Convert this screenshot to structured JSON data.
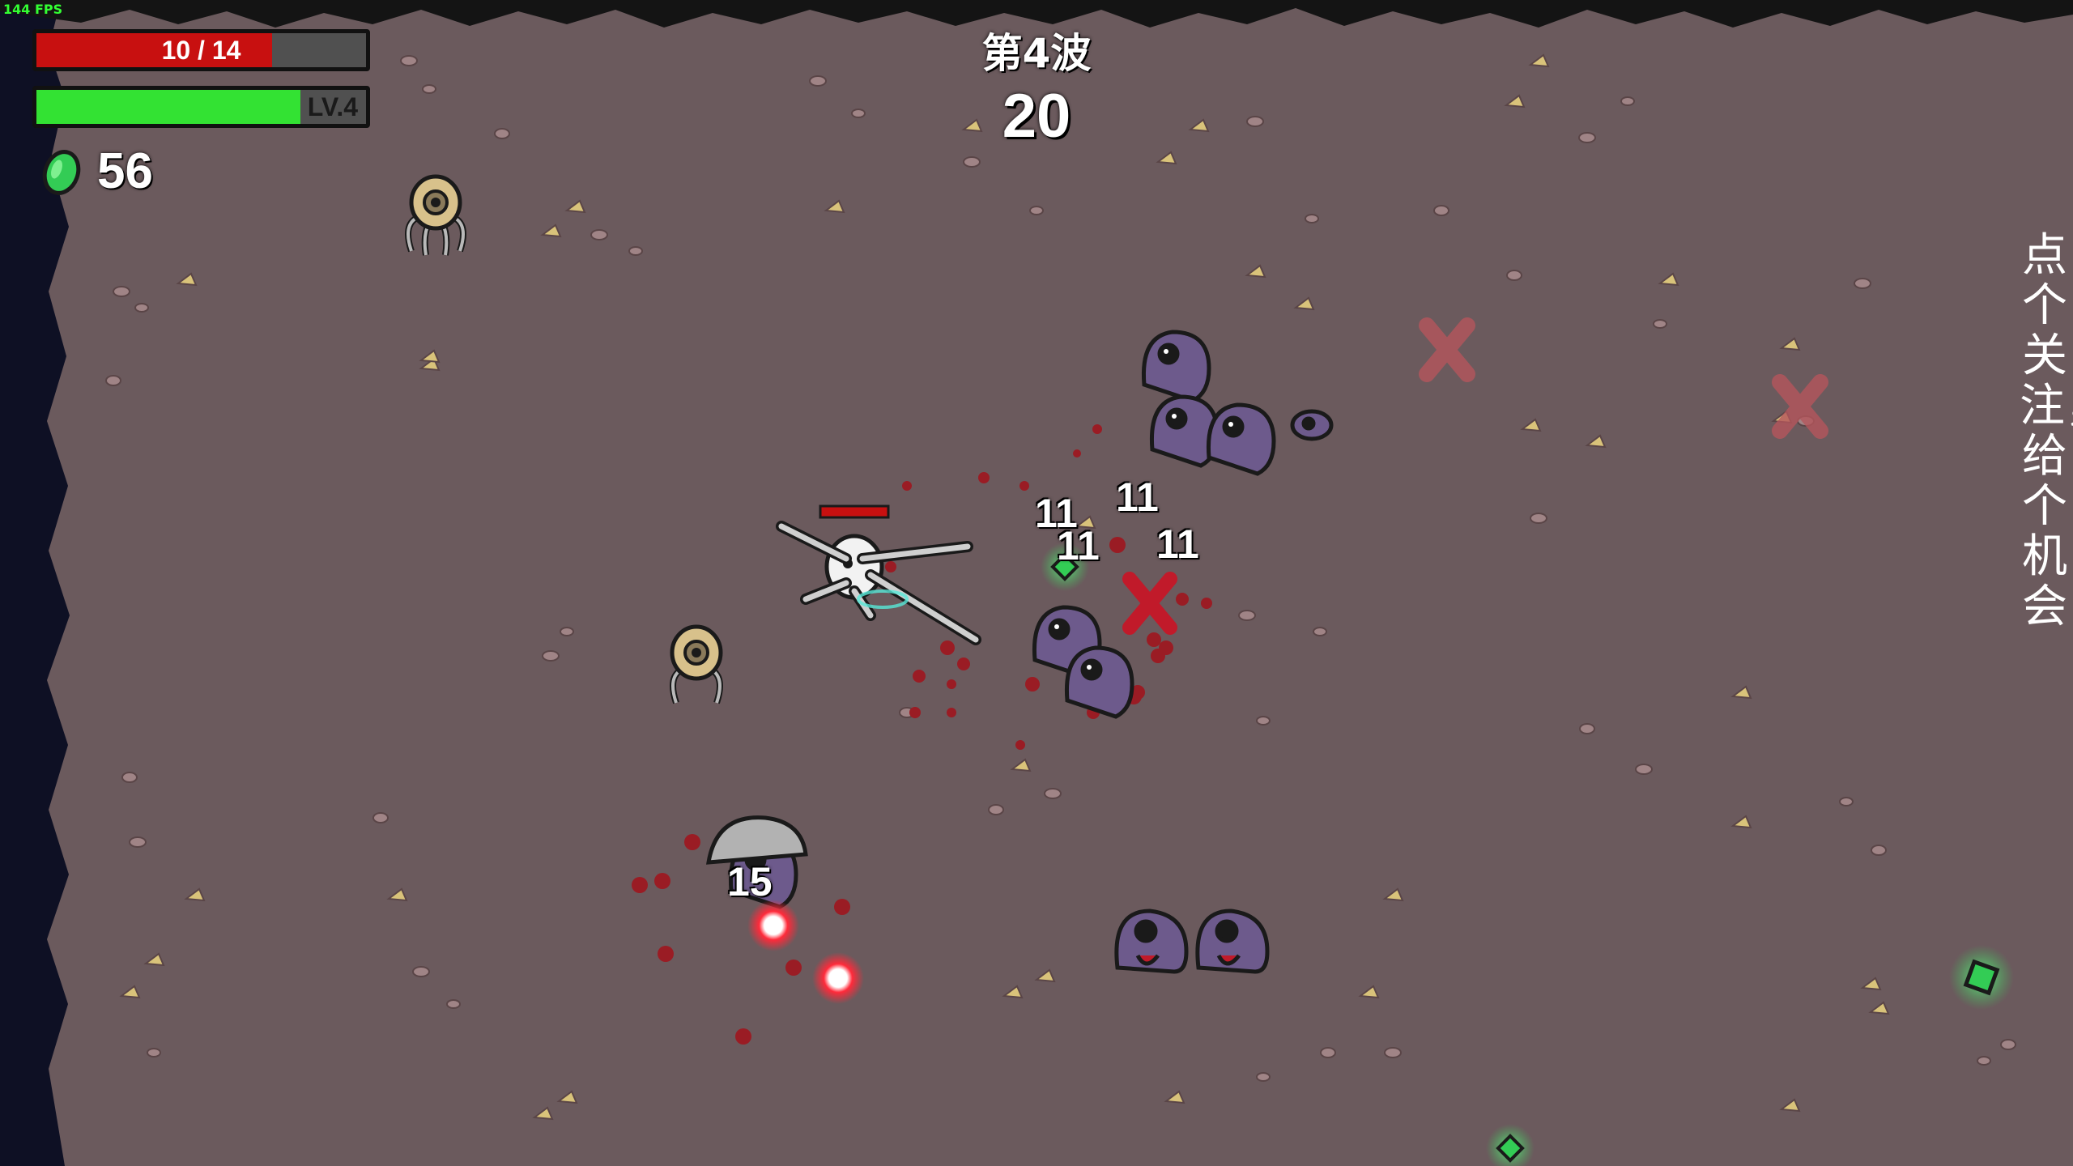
{
  "hud": {
    "fps": "144 FPS",
    "hp_text": "10 / 14",
    "hp_current": 10,
    "hp_max": 14,
    "level_text": "LV.4",
    "xp_fraction": 0.8,
    "materials": "56",
    "wave": "第4波",
    "timer": "20"
  },
  "damage_numbers": [
    "11",
    "11",
    "11",
    "11",
    "15"
  ],
  "side_note": "点个关注，给个机会",
  "colors": {
    "ground": "#6b5a5d",
    "hp_fill": "#c81010",
    "xp_fill": "#33e233",
    "enemy": "#6d5a8c",
    "material": "#33cc55",
    "projectile": "#ff2a3a"
  },
  "icons": {
    "material": "material-gem-icon",
    "player": "potato-player",
    "enemy_slime": "alien-slime-icon",
    "tree": "tree-turret-icon"
  }
}
